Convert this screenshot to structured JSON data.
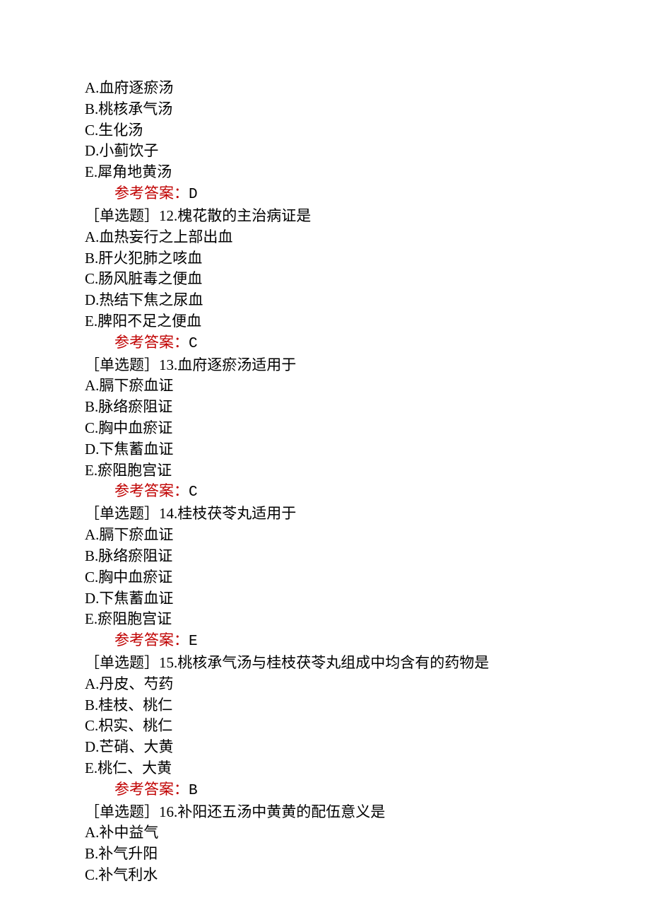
{
  "answerLabel": "参考答案：",
  "q11": {
    "options": {
      "A": "A.血府逐瘀汤",
      "B": "B.桃核承气汤",
      "C": "C.生化汤",
      "D": "D.小蓟饮子",
      "E": "E.犀角地黄汤"
    },
    "answer": "D"
  },
  "q12": {
    "prompt": "［单选题］12.槐花散的主治病证是",
    "options": {
      "A": "A.血热妄行之上部出血",
      "B": "B.肝火犯肺之咳血",
      "C": "C.肠风脏毒之便血",
      "D": "D.热结下焦之尿血",
      "E": "E.脾阳不足之便血"
    },
    "answer": "C"
  },
  "q13": {
    "prompt": "［单选题］13.血府逐瘀汤适用于",
    "options": {
      "A": "A.膈下瘀血证",
      "B": "B.脉络瘀阻证",
      "C": "C.胸中血瘀证",
      "D": "D.下焦蓄血证",
      "E": "E.瘀阻胞宫证"
    },
    "answer": "C"
  },
  "q14": {
    "prompt": "［单选题］14.桂枝茯苓丸适用于",
    "options": {
      "A": "A.膈下瘀血证",
      "B": "B.脉络瘀阻证",
      "C": "C.胸中血瘀证",
      "D": "D.下焦蓄血证",
      "E": "E.瘀阻胞宫证"
    },
    "answer": "E"
  },
  "q15": {
    "prompt": "［单选题］15.桃核承气汤与桂枝茯苓丸组成中均含有的药物是",
    "options": {
      "A": "A.丹皮、芍药",
      "B": "B.桂枝、桃仁",
      "C": "C.枳实、桃仁",
      "D": "D.芒硝、大黄",
      "E": "E.桃仁、大黄"
    },
    "answer": "B"
  },
  "q16": {
    "prompt": "［单选题］16.补阳还五汤中黄黄的配伍意义是",
    "options": {
      "A": "A.补中益气",
      "B": "B.补气升阳",
      "C": "C.补气利水"
    }
  }
}
